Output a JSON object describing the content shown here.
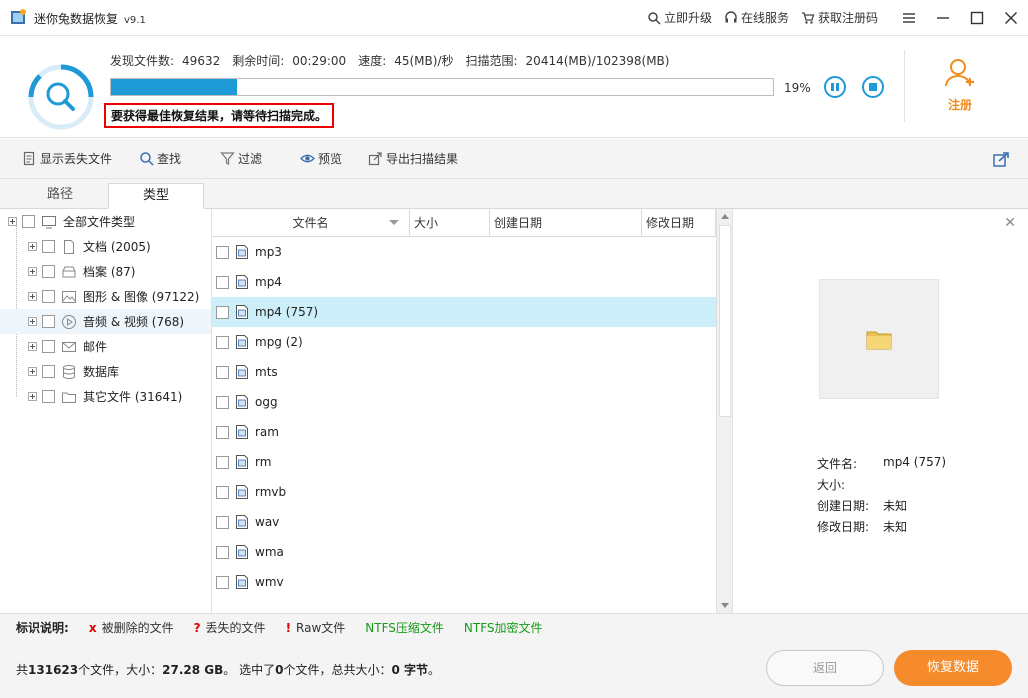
{
  "titlebar": {
    "title": "迷你兔数据恢复",
    "version": "v9.1",
    "links": [
      {
        "label": "立即升级",
        "icon": "search-icon"
      },
      {
        "label": "在线服务",
        "icon": "headset-icon"
      },
      {
        "label": "获取注册码",
        "icon": "cart-icon"
      }
    ]
  },
  "scan": {
    "found_label": "发现文件数:",
    "found_value": "49632",
    "remaining_label": "剩余时间:",
    "remaining_value": "00:29:00",
    "speed_label": "速度:",
    "speed_value": "45(MB)/秒",
    "range_label": "扫描范围:",
    "range_value": "20414(MB)/102398(MB)",
    "progress_fraction": 0.19,
    "progress_text": "19%",
    "hint": "要获得最佳恢复结果，请等待扫描完成。",
    "register_label": "注册"
  },
  "toolbar": {
    "show_lost": "显示丢失文件",
    "find": "查找",
    "filter": "过滤",
    "preview": "预览",
    "export": "导出扫描结果"
  },
  "tabs": [
    {
      "label": "路径"
    },
    {
      "label": "类型"
    }
  ],
  "tree": {
    "root": "全部文件类型",
    "items": [
      {
        "label": "文档 (2005)",
        "icon": "document-icon"
      },
      {
        "label": "档案 (87)",
        "icon": "archive-icon"
      },
      {
        "label": "图形 & 图像 (97122)",
        "icon": "image-icon"
      },
      {
        "label": "音频 & 视频 (768)",
        "icon": "media-icon"
      },
      {
        "label": "邮件",
        "icon": "mail-icon"
      },
      {
        "label": "数据库",
        "icon": "database-icon"
      },
      {
        "label": "其它文件 (31641)",
        "icon": "folder-icon"
      }
    ]
  },
  "list": {
    "columns": [
      "文件名",
      "大小",
      "创建日期",
      "修改日期"
    ],
    "rows": [
      {
        "name": "mp3"
      },
      {
        "name": "mp4"
      },
      {
        "name": "mp4 (757)"
      },
      {
        "name": "mpg (2)"
      },
      {
        "name": "mts"
      },
      {
        "name": "ogg"
      },
      {
        "name": "ram"
      },
      {
        "name": "rm"
      },
      {
        "name": "rmvb"
      },
      {
        "name": "wav"
      },
      {
        "name": "wma"
      },
      {
        "name": "wmv"
      }
    ]
  },
  "preview": {
    "filename_label": "文件名:",
    "filename_value": "mp4 (757)",
    "size_label": "大小:",
    "size_value": "",
    "created_label": "创建日期:",
    "created_value": "未知",
    "modified_label": "修改日期:",
    "modified_value": "未知"
  },
  "legend": {
    "title": "标识说明:",
    "deleted_mark": "x",
    "deleted": "被删除的文件",
    "lost_mark": "?",
    "lost": "丢失的文件",
    "raw_mark": "!",
    "raw": "Raw文件",
    "ntfs_compressed": "NTFS压缩文件",
    "ntfs_encrypted": "NTFS加密文件"
  },
  "status": {
    "p1": "共",
    "total_files": "131623",
    "p2": "个文件，大小：",
    "total_size": "27.28 GB",
    "p3": "。 选中了",
    "selected_count": "0",
    "p4": "个文件，总共大小：",
    "selected_size": "0 字节",
    "p5": "。"
  },
  "buttons": {
    "back": "返回",
    "recover": "恢复数据"
  },
  "colors": {
    "accent": "#1e9ad6",
    "orange": "#f58b2a",
    "red_mark": "#e00000",
    "green_text": "#1a9a1a"
  }
}
